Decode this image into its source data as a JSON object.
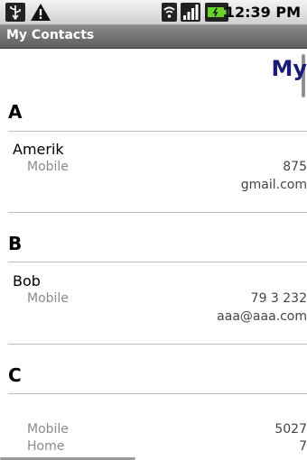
{
  "status": {
    "time": "12:39 PM"
  },
  "app": {
    "title": "My Contacts",
    "heading": "My"
  },
  "sections": [
    {
      "letter": "A",
      "contacts": [
        {
          "name": "Amerik",
          "phones": [
            {
              "type": "Mobile",
              "number": "875"
            }
          ],
          "email": "gmail.com"
        }
      ]
    },
    {
      "letter": "B",
      "contacts": [
        {
          "name": "Bob",
          "phones": [
            {
              "type": "Mobile",
              "number": "79 3   232"
            }
          ],
          "email": "aaa@aaa.com"
        }
      ]
    },
    {
      "letter": "C",
      "contacts": [
        {
          "name": "",
          "phones": [
            {
              "type": "Mobile",
              "number": "5027"
            },
            {
              "type": "Home",
              "number": "7"
            }
          ]
        }
      ]
    }
  ]
}
